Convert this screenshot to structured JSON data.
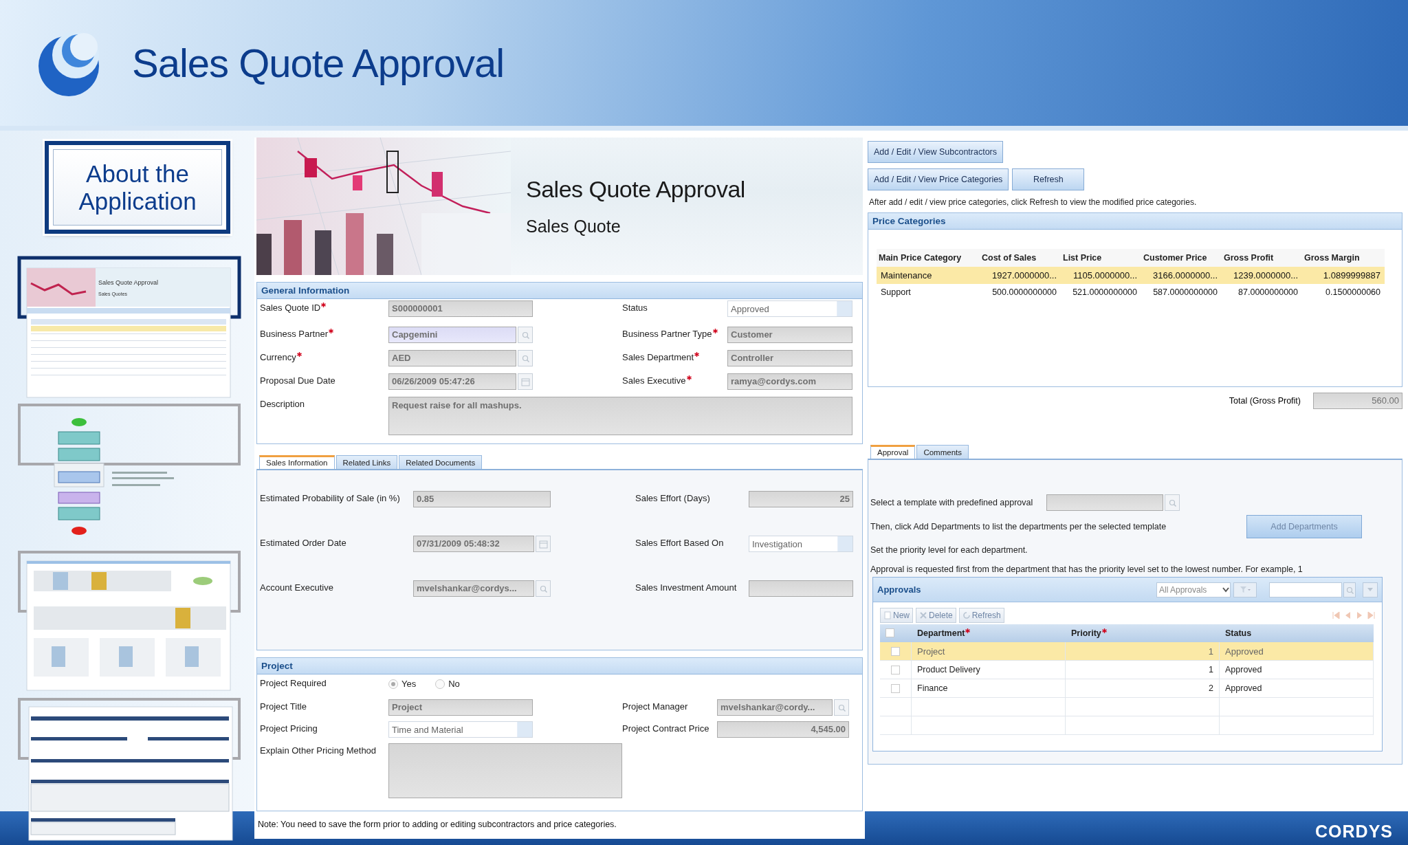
{
  "slide": {
    "title": "Sales Quote Approval",
    "sidebar_heading": "About the Application",
    "thumbnails": [
      {
        "kind": "screen",
        "selected": true,
        "title": "Sales Quote Approval",
        "subtitle": "Sales Quotes"
      },
      {
        "kind": "flowchart",
        "selected": false
      },
      {
        "kind": "charts",
        "selected": false
      },
      {
        "kind": "report",
        "selected": false
      }
    ],
    "footer_logo": "CORDYS"
  },
  "form": {
    "banner": {
      "title": "Sales Quote Approval",
      "subtitle": "Sales Quote"
    },
    "general": {
      "title": "General Information",
      "rows": [
        {
          "left": {
            "label": "Sales Quote ID",
            "required": true,
            "kind": "text",
            "value": "S000000001"
          },
          "right": {
            "label": "Status",
            "required": false,
            "kind": "select",
            "value": "Approved"
          }
        },
        {
          "left": {
            "label": "Business Partner",
            "required": true,
            "kind": "lookup",
            "value": "Capgemini",
            "focused": true
          },
          "right": {
            "label": "Business Partner Type",
            "required": true,
            "kind": "text",
            "value": "Customer"
          }
        },
        {
          "left": {
            "label": "Currency",
            "required": true,
            "kind": "lookup",
            "value": "AED"
          },
          "right": {
            "label": "Sales Department",
            "required": true,
            "kind": "text",
            "value": "Controller"
          }
        },
        {
          "left": {
            "label": "Proposal Due Date",
            "required": false,
            "kind": "date",
            "value": "06/26/2009 05:47:26"
          },
          "right": {
            "label": "Sales Executive",
            "required": true,
            "kind": "text",
            "value": "ramya@cordys.com"
          }
        },
        {
          "left": {
            "label": "Description",
            "required": false,
            "kind": "textarea",
            "value": "Request raise for all mashups."
          }
        }
      ]
    },
    "tabs": [
      {
        "label": "Sales Information",
        "selected": true
      },
      {
        "label": "Related Links",
        "selected": false
      },
      {
        "label": "Related Documents",
        "selected": false
      }
    ],
    "sales_rows": [
      {
        "left": {
          "label": "Estimated Probability of Sale (in %)",
          "required": false,
          "kind": "text",
          "value": "0.85"
        },
        "right": {
          "label": "Sales Effort (Days)",
          "required": false,
          "kind": "number",
          "value": "25"
        }
      },
      {
        "left": {
          "label": "Estimated Order Date",
          "required": false,
          "kind": "date",
          "value": "07/31/2009 05:48:32"
        },
        "right": {
          "label": "Sales Effort Based On",
          "required": false,
          "kind": "select",
          "value": "Investigation"
        }
      },
      {
        "left": {
          "label": "Account Executive",
          "required": false,
          "kind": "lookup",
          "value": "mvelshankar@cordys..."
        },
        "right": {
          "label": "Sales Investment Amount",
          "required": false,
          "kind": "number"
        }
      }
    ],
    "project": {
      "title": "Project",
      "rows": [
        {
          "left": {
            "label": "Project Required",
            "required": false,
            "kind": "radio",
            "options": [
              {
                "label": "Yes",
                "selected": true
              },
              {
                "label": "No",
                "selected": false
              }
            ]
          }
        },
        {
          "left": {
            "label": "Project Title",
            "required": false,
            "kind": "text",
            "value": "Project"
          },
          "right": {
            "label": "Project Manager",
            "required": false,
            "kind": "lookup",
            "value": "mvelshankar@cordy..."
          }
        },
        {
          "left": {
            "label": "Project Pricing",
            "required": false,
            "kind": "select",
            "value": "Time and Material"
          },
          "right": {
            "label": "Project Contract Price",
            "required": false,
            "kind": "number",
            "value": "4,545.00"
          }
        },
        {
          "left": {
            "label": "Explain Other Pricing Method",
            "required": false,
            "kind": "textarea"
          }
        }
      ]
    },
    "note": "Note: You need to save the form prior to adding or editing subcontractors and price categories."
  },
  "side": {
    "button_rows": [
      [
        {
          "label": "Add / Edit / View Subcontractors"
        }
      ],
      [
        {
          "label": "Add / Edit / View Price Categories"
        },
        {
          "label": "Refresh"
        }
      ]
    ],
    "hint": "After add / edit / view price categories, click Refresh to view the modified price categories.",
    "price_categories": {
      "title": "Price Categories",
      "columns": [
        "Main Price Category",
        "Cost of Sales",
        "List Price",
        "Customer Price",
        "Gross Profit",
        "Gross Margin"
      ],
      "rows": [
        {
          "selected": true,
          "cells": [
            "Maintenance",
            "1927.0000000...",
            "1105.0000000...",
            "3166.0000000...",
            "1239.0000000...",
            "1.0899999887"
          ]
        },
        {
          "selected": false,
          "cells": [
            "Support",
            "500.0000000000",
            "521.0000000000",
            "587.0000000000",
            "87.0000000000",
            "0.1500000060"
          ]
        }
      ]
    },
    "total": {
      "label": "Total (Gross Profit)",
      "value": "560.00"
    },
    "tabs": [
      {
        "label": "Approval",
        "selected": true
      },
      {
        "label": "Comments",
        "selected": false
      }
    ],
    "template_label": "Select a template with predefined approval",
    "add_text": "Then, click Add Departments to list the departments per the selected template",
    "add_button": {
      "label": "Add Departments",
      "disabled": true
    },
    "priority_text": "Set the priority level for each department.",
    "approval_text": "Approval is requested first from the department that has the priority level set to the lowest number. For example, 1",
    "approvals": {
      "title": "Approvals",
      "filter": "All Approvals",
      "toolbar": [
        {
          "label": "New",
          "disabled": true
        },
        {
          "label": "Delete",
          "disabled": true
        },
        {
          "label": "Refresh",
          "disabled": true
        }
      ],
      "columns": [
        {
          "label": "Department",
          "required": true
        },
        {
          "label": "Priority",
          "required": true
        },
        {
          "label": "Status",
          "required": false
        }
      ],
      "header_checked": false,
      "rows": [
        {
          "selected": true,
          "checked": false,
          "cells": [
            "Project",
            "1",
            "Approved"
          ]
        },
        {
          "selected": false,
          "checked": false,
          "cells": [
            "Product Delivery",
            "1",
            "Approved"
          ]
        },
        {
          "selected": false,
          "checked": false,
          "cells": [
            "Finance",
            "2",
            "Approved"
          ]
        }
      ]
    }
  }
}
